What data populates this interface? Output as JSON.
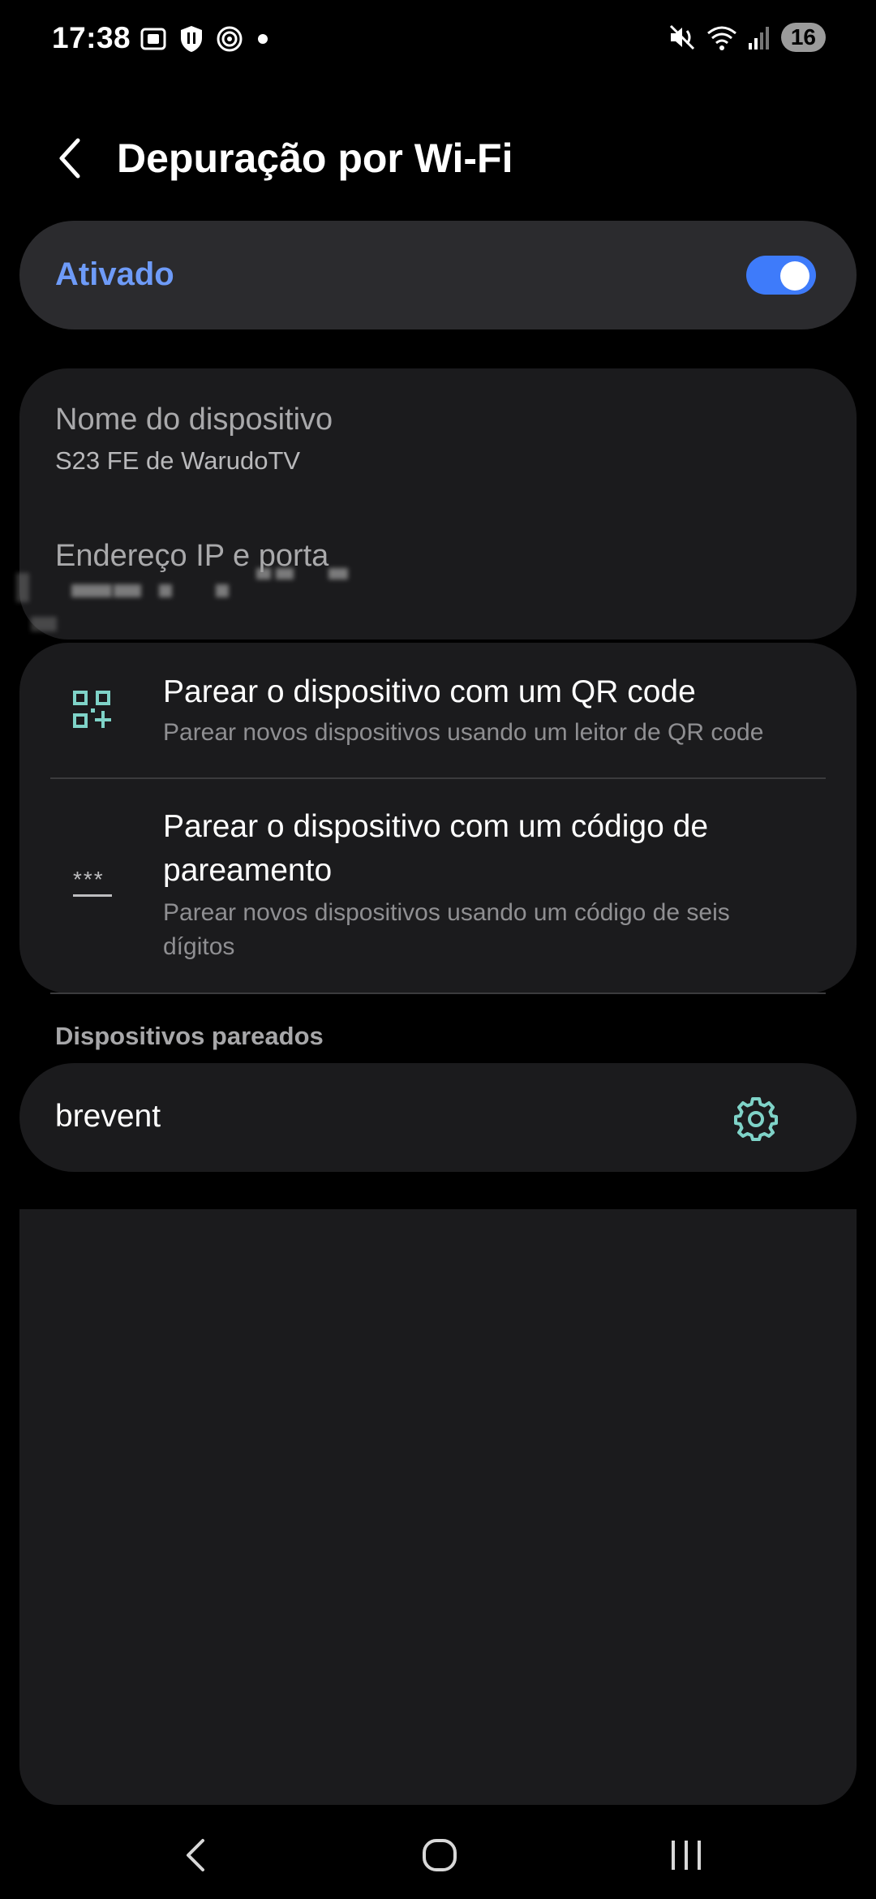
{
  "status_bar": {
    "time": "17:38",
    "battery": "16",
    "left_icons": [
      "screenshot-icon",
      "shield-icon",
      "swirl-icon",
      "dot-icon"
    ],
    "right_icons": [
      "mute-icon",
      "wifi-icon",
      "signal-icon"
    ]
  },
  "header": {
    "title": "Depuração por Wi-Fi"
  },
  "toggle": {
    "label": "Ativado",
    "on": true,
    "accent": "#3e7bfa",
    "label_color": "#6e9bf8"
  },
  "device_info": {
    "name_title": "Nome do dispositivo",
    "name_value": "S23 FE de WarudoTV",
    "ip_title": "Endereço IP e porta"
  },
  "pairing": {
    "qr": {
      "title": "Parear o dispositivo com um QR code",
      "subtitle": "Parear novos dispositivos usando um leitor de QR code",
      "icon": "qr-code-add-icon"
    },
    "code": {
      "title_line1": "Parear o dispositivo com um código de",
      "title_line2": "pareamento",
      "subtitle_line1": "Parear novos dispositivos usando um código de seis",
      "subtitle_line2": "dígitos",
      "icon": "password-dots-icon",
      "icon_text": "***"
    }
  },
  "paired_devices": {
    "header": "Dispositivos pareados",
    "items": [
      {
        "name": "brevent",
        "icon": "gear-icon"
      }
    ],
    "icon_color": "#7fd3c8"
  },
  "nav_bar": {
    "buttons": [
      "back-icon",
      "home-icon",
      "recents-icon"
    ]
  }
}
